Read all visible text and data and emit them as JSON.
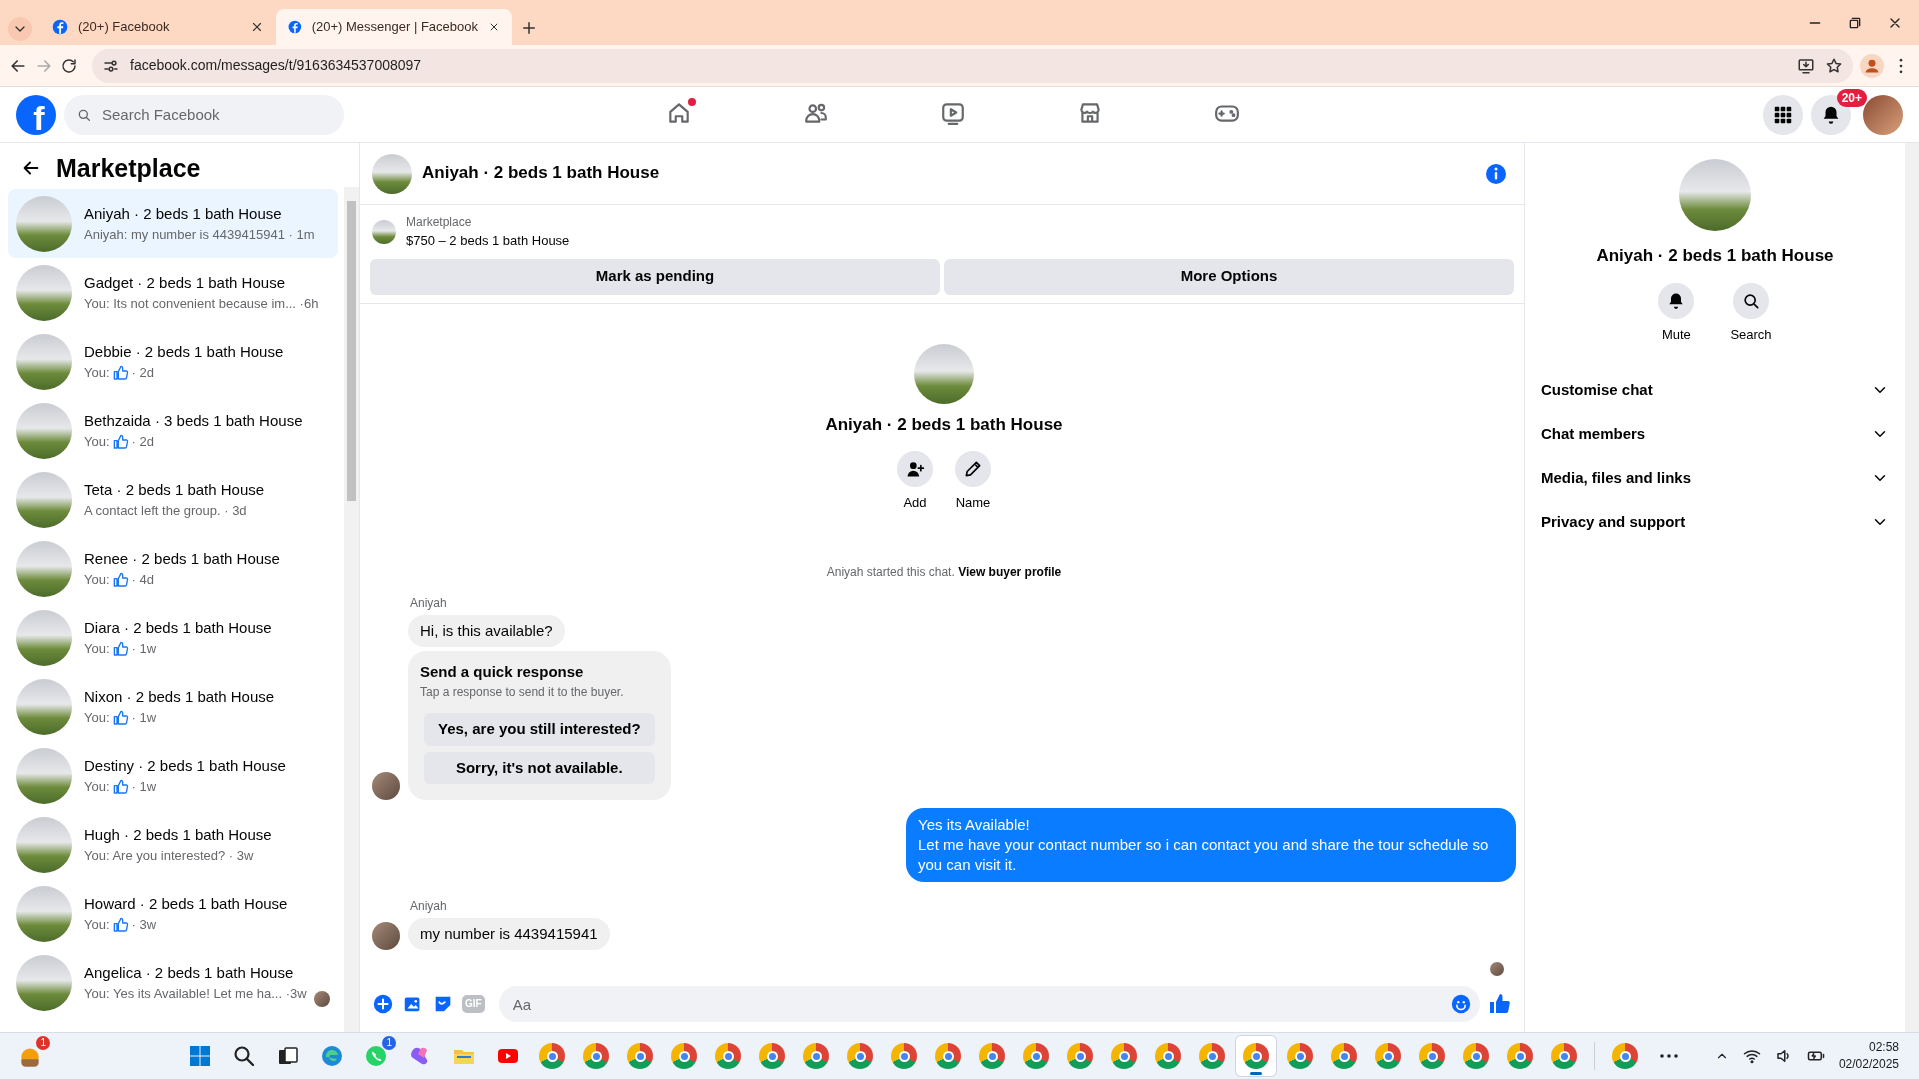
{
  "browser": {
    "tabs": [
      {
        "title": "(20+) Facebook",
        "selected": false
      },
      {
        "title": "(20+) Messenger | Facebook",
        "selected": true
      }
    ],
    "url": "facebook.com/messages/t/9163634537008097"
  },
  "header": {
    "logo": "f",
    "search_placeholder": "Search Facebook",
    "nav": [
      {
        "kind": "home",
        "selected": false,
        "dot": true
      },
      {
        "kind": "friends",
        "selected": false
      },
      {
        "kind": "video",
        "selected": false
      },
      {
        "kind": "marketplace",
        "selected": false
      },
      {
        "kind": "gaming",
        "selected": false
      }
    ],
    "notification_badge": "20+"
  },
  "sidebar": {
    "title": "Marketplace",
    "conversations": [
      {
        "title": "Aniyah · 2 beds 1 bath House",
        "kind": "text",
        "preview": "Aniyah: my number is 4439415941 · 1m",
        "selected": true
      },
      {
        "title": "Gadget · 2 beds 1 bath House",
        "kind": "text",
        "preview": "You: Its not convenient because im... ·6h",
        "selected": false
      },
      {
        "title": "Debbie · 2 beds 1 bath House",
        "kind": "like",
        "prefix": "You:",
        "suffix": "· 2d",
        "selected": false
      },
      {
        "title": "Bethzaida · 3 beds 1 bath House",
        "kind": "like",
        "prefix": "You:",
        "suffix": "· 2d",
        "selected": false
      },
      {
        "title": "Teta · 2 beds 1 bath House",
        "kind": "text",
        "preview": "A contact left the group. · 3d",
        "selected": false
      },
      {
        "title": "Renee · 2 beds 1 bath House",
        "kind": "like",
        "prefix": "You:",
        "suffix": "· 4d",
        "selected": false
      },
      {
        "title": "Diara · 2 beds 1 bath House",
        "kind": "like",
        "prefix": "You:",
        "suffix": "· 1w",
        "selected": false
      },
      {
        "title": "Nixon · 2 beds 1 bath House",
        "kind": "like",
        "prefix": "You:",
        "suffix": "· 1w",
        "selected": false
      },
      {
        "title": "Destiny · 2 beds 1 bath House",
        "kind": "like",
        "prefix": "You:",
        "suffix": "· 1w",
        "selected": false
      },
      {
        "title": "Hugh · 2 beds 1 bath House",
        "kind": "text",
        "preview": "You: Are you interested? · 3w",
        "selected": false
      },
      {
        "title": "Howard · 2 beds 1 bath House",
        "kind": "like",
        "prefix": "You:",
        "suffix": "· 3w",
        "selected": false
      },
      {
        "title": "Angelica · 2 beds 1 bath House",
        "kind": "text",
        "preview": "You: Yes its Available! Let me ha... ·3w",
        "selected": false,
        "seen": true
      }
    ]
  },
  "chat": {
    "title": "Aniyah · 2 beds 1 bath House",
    "listing": {
      "label": "Marketplace",
      "price": "$750 – 2 beds 1 bath House",
      "buttons": [
        "Mark as pending",
        "More Options"
      ]
    },
    "intro": {
      "title": "Aniyah · 2 beds 1 bath House",
      "actions": [
        {
          "kind": "add",
          "label": "Add"
        },
        {
          "kind": "name",
          "label": "Name"
        }
      ]
    },
    "notice": {
      "text": "Aniyah started this chat.",
      "link": "View buyer profile"
    },
    "messages": [
      {
        "kind": "incoming",
        "sender": "Aniyah",
        "text": "Hi, is this available?"
      },
      {
        "kind": "quick_response",
        "title": "Send a quick response",
        "subtitle": "Tap a response to send it to the buyer.",
        "options": [
          "Yes, are you still interested?",
          "Sorry, it's not available."
        ],
        "avatar": true
      },
      {
        "kind": "outgoing",
        "text": "Yes its Available!\nLet me have your contact number so i can contact you and share the tour schedule so you can visit it."
      },
      {
        "kind": "incoming",
        "sender": "Aniyah",
        "text": "my number is 4439415941",
        "avatar": true
      }
    ],
    "read_receipt": true,
    "composer": {
      "placeholder": "Aa",
      "gif": "GIF"
    }
  },
  "details": {
    "title": "Aniyah · 2 beds 1 bath House",
    "actions": [
      {
        "kind": "mute",
        "label": "Mute"
      },
      {
        "kind": "search",
        "label": "Search"
      }
    ],
    "sections": [
      {
        "label": "Customise chat",
        "expanded": false
      },
      {
        "label": "Chat members",
        "expanded": false
      },
      {
        "label": "Media, files and links",
        "expanded": false
      },
      {
        "label": "Privacy and support",
        "expanded": false
      }
    ]
  },
  "taskbar": {
    "widget_badge": "1",
    "apps": [
      {
        "kind": "start",
        "selected": false
      },
      {
        "kind": "search",
        "selected": false
      },
      {
        "kind": "taskview",
        "selected": false
      },
      {
        "kind": "edge",
        "selected": false
      },
      {
        "kind": "whatsapp",
        "selected": false,
        "badge": "1"
      },
      {
        "kind": "copilot",
        "selected": false
      },
      {
        "kind": "explorer",
        "selected": false
      },
      {
        "kind": "youtube",
        "selected": false
      },
      {
        "kind": "chrome",
        "selected": false
      },
      {
        "kind": "chrome",
        "selected": false
      },
      {
        "kind": "chrome",
        "selected": false
      },
      {
        "kind": "chrome",
        "selected": false
      },
      {
        "kind": "chrome",
        "selected": false
      },
      {
        "kind": "chrome",
        "selected": false
      },
      {
        "kind": "chrome",
        "selected": false
      },
      {
        "kind": "chrome",
        "selected": false
      },
      {
        "kind": "chrome",
        "selected": false
      },
      {
        "kind": "chrome",
        "selected": false
      },
      {
        "kind": "chrome",
        "selected": false
      },
      {
        "kind": "chrome",
        "selected": false
      },
      {
        "kind": "chrome",
        "selected": false
      },
      {
        "kind": "chrome",
        "selected": false
      },
      {
        "kind": "chrome",
        "selected": false
      },
      {
        "kind": "chrome",
        "selected": false
      },
      {
        "kind": "chrome",
        "selected": true
      },
      {
        "kind": "chrome",
        "selected": false
      },
      {
        "kind": "chrome",
        "selected": false
      },
      {
        "kind": "chrome",
        "selected": false
      },
      {
        "kind": "chrome",
        "selected": false
      },
      {
        "kind": "chrome",
        "selected": false
      },
      {
        "kind": "chrome",
        "selected": false
      },
      {
        "kind": "chrome",
        "selected": false
      }
    ],
    "extra_apps": [
      {
        "kind": "chrome",
        "selected": false
      },
      {
        "kind": "more",
        "selected": false
      }
    ],
    "time": "02:58",
    "date": "02/02/2025"
  }
}
